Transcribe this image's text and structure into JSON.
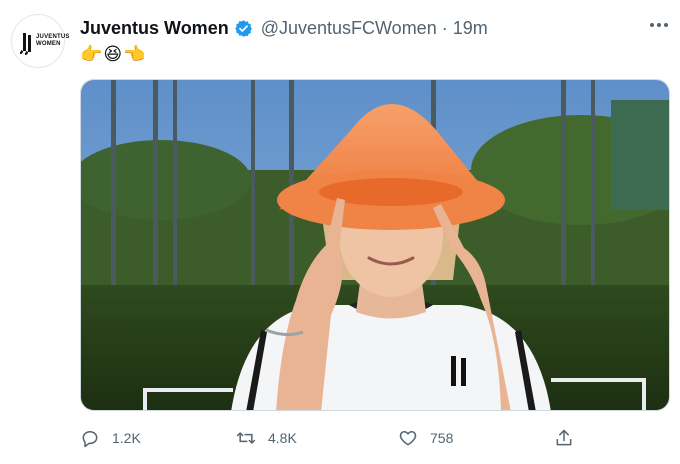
{
  "tweet": {
    "author_name": "Juventus Women",
    "handle": "@JuventusFCWomen",
    "separator": "·",
    "time": "19m",
    "text": "👉😆👈",
    "verified_color": "#1d9bf0",
    "avatar": {
      "logo_text_line1": "JUVENTUS",
      "logo_text_line2": "WOMEN"
    },
    "media": {
      "alt_subject": "player wearing orange training cone as a hat, pointing at head"
    },
    "actions": {
      "reply_count": "1.2K",
      "retweet_count": "4.8K",
      "like_count": "758"
    },
    "icons": [
      "verified-badge-icon",
      "more-icon",
      "reply-icon",
      "retweet-icon",
      "like-icon",
      "share-icon"
    ]
  }
}
